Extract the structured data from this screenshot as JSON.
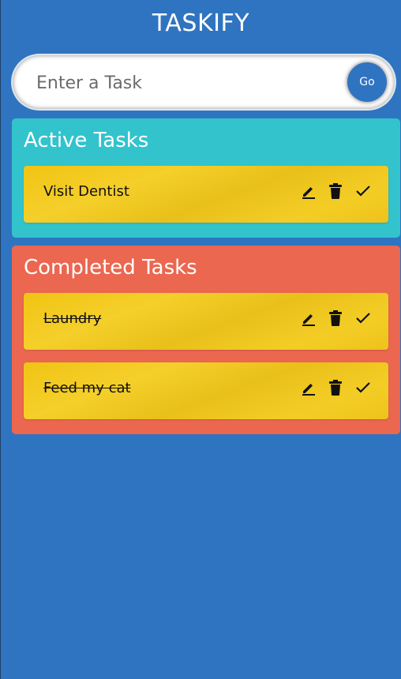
{
  "app": {
    "title": "TASKIFY"
  },
  "input": {
    "placeholder": "Enter a Task",
    "value": "",
    "submit_label": "Go"
  },
  "active": {
    "title": "Active Tasks",
    "tasks": [
      {
        "text": "Visit Dentist"
      }
    ]
  },
  "completed": {
    "title": "Completed Tasks",
    "tasks": [
      {
        "text": "Laundry"
      },
      {
        "text": "Feed my cat"
      }
    ]
  },
  "icons": {
    "edit": "pencil-icon",
    "delete": "trash-icon",
    "done": "check-icon"
  },
  "colors": {
    "background": "#2f74c0",
    "active_panel": "#32c3cd",
    "completed_panel": "#eb6750",
    "task_card": "#f2c81e"
  }
}
